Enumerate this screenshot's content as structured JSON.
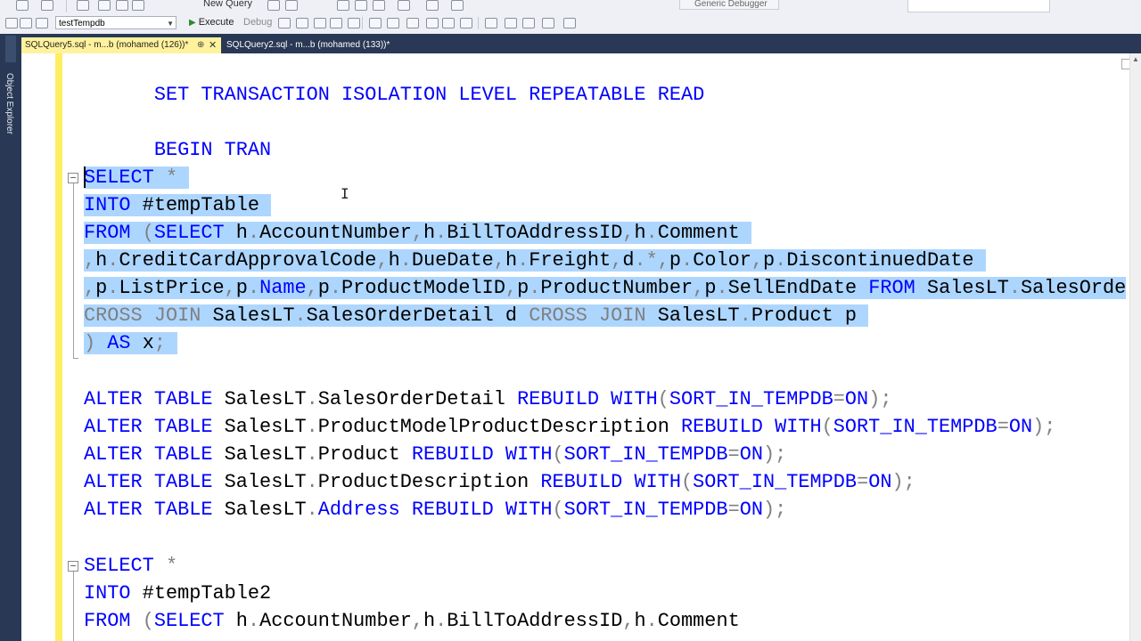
{
  "toolbar": {
    "new_query_label": "New Query",
    "database": "testTempdb",
    "execute_label": "Execute",
    "debug_label": "Debug",
    "debugger": "Generic Debugger"
  },
  "side_panel": {
    "label": "Object Explorer"
  },
  "tabs": [
    {
      "label": "SQLQuery5.sql - m...b (mohamed (126))*",
      "active": true
    },
    {
      "label": "SQLQuery2.sql - m...b (mohamed (133))*",
      "active": false
    }
  ],
  "code": {
    "line1": [
      "SET TRANSACTION ISOLATION LEVEL REPEATABLE READ"
    ],
    "line2": [
      "BEGIN TRAN"
    ],
    "sel1": [
      "SELECT",
      " ",
      "*"
    ],
    "sel2": [
      "INTO",
      " #tempTable"
    ],
    "sel3": [
      "FROM",
      " ",
      "(",
      "SELECT",
      " h",
      ".",
      "AccountNumber",
      ",",
      "h",
      ".",
      "BillToAddressID",
      ",",
      "h",
      ".",
      "Comment"
    ],
    "sel4": [
      ",",
      "h",
      ".",
      "CreditCardApprovalCode",
      ",",
      "h",
      ".",
      "DueDate",
      ",",
      "h",
      ".",
      "Freight",
      ",",
      "d",
      ".",
      "*",
      ",",
      "p",
      ".",
      "Color",
      ",",
      "p",
      ".",
      "DiscontinuedDate"
    ],
    "sel5": [
      ",",
      "p",
      ".",
      "ListPrice",
      ",",
      "p",
      ".",
      "Name",
      ",",
      "p",
      ".",
      "ProductModelID",
      ",",
      "p",
      ".",
      "ProductNumber",
      ",",
      "p",
      ".",
      "SellEndDate",
      " ",
      "FROM",
      " SalesLT",
      ".",
      "SalesOrde"
    ],
    "sel6": [
      "CROSS JOIN",
      " SalesLT",
      ".",
      "SalesOrderDetail d ",
      "CROSS JOIN",
      " SalesLT",
      ".",
      "Product p"
    ],
    "sel7": [
      ")",
      " ",
      "AS",
      " x",
      ";"
    ],
    "alter1": [
      "ALTER TABLE",
      " SalesLT",
      ".",
      "SalesOrderDetail ",
      "REBUILD WITH",
      "(",
      "SORT_IN_TEMPDB",
      "=",
      "ON",
      ");"
    ],
    "alter2": [
      "ALTER TABLE",
      " SalesLT",
      ".",
      "ProductModelProductDescription ",
      "REBUILD WITH",
      "(",
      "SORT_IN_TEMPDB",
      "=",
      "ON",
      ");"
    ],
    "alter3": [
      "ALTER TABLE",
      " SalesLT",
      ".",
      "Product ",
      "REBUILD WITH",
      "(",
      "SORT_IN_TEMPDB",
      "=",
      "ON",
      ");"
    ],
    "alter4": [
      "ALTER TABLE",
      " SalesLT",
      ".",
      "ProductDescription ",
      "REBUILD WITH",
      "(",
      "SORT_IN_TEMPDB",
      "=",
      "ON",
      ");"
    ],
    "alter5": [
      "ALTER TABLE",
      " SalesLT",
      ".",
      "Address",
      " ",
      "REBUILD WITH",
      "(",
      "SORT_IN_TEMPDB",
      "=",
      "ON",
      ");"
    ],
    "sel2_1": [
      "SELECT",
      " ",
      "*"
    ],
    "sel2_2": [
      "INTO",
      " #tempTable2"
    ],
    "sel2_3": [
      "FROM",
      " ",
      "(",
      "SELECT",
      " h",
      ".",
      "AccountNumber",
      ",",
      "h",
      ".",
      "BillToAddressID",
      ",",
      "h",
      ".",
      "Comment"
    ]
  },
  "colors": {
    "keyword": "#0000ff",
    "operator": "#808080",
    "function": "#ff00ff",
    "selection": "#add6ff",
    "active_tab": "#fff29d",
    "chrome": "#293955"
  }
}
